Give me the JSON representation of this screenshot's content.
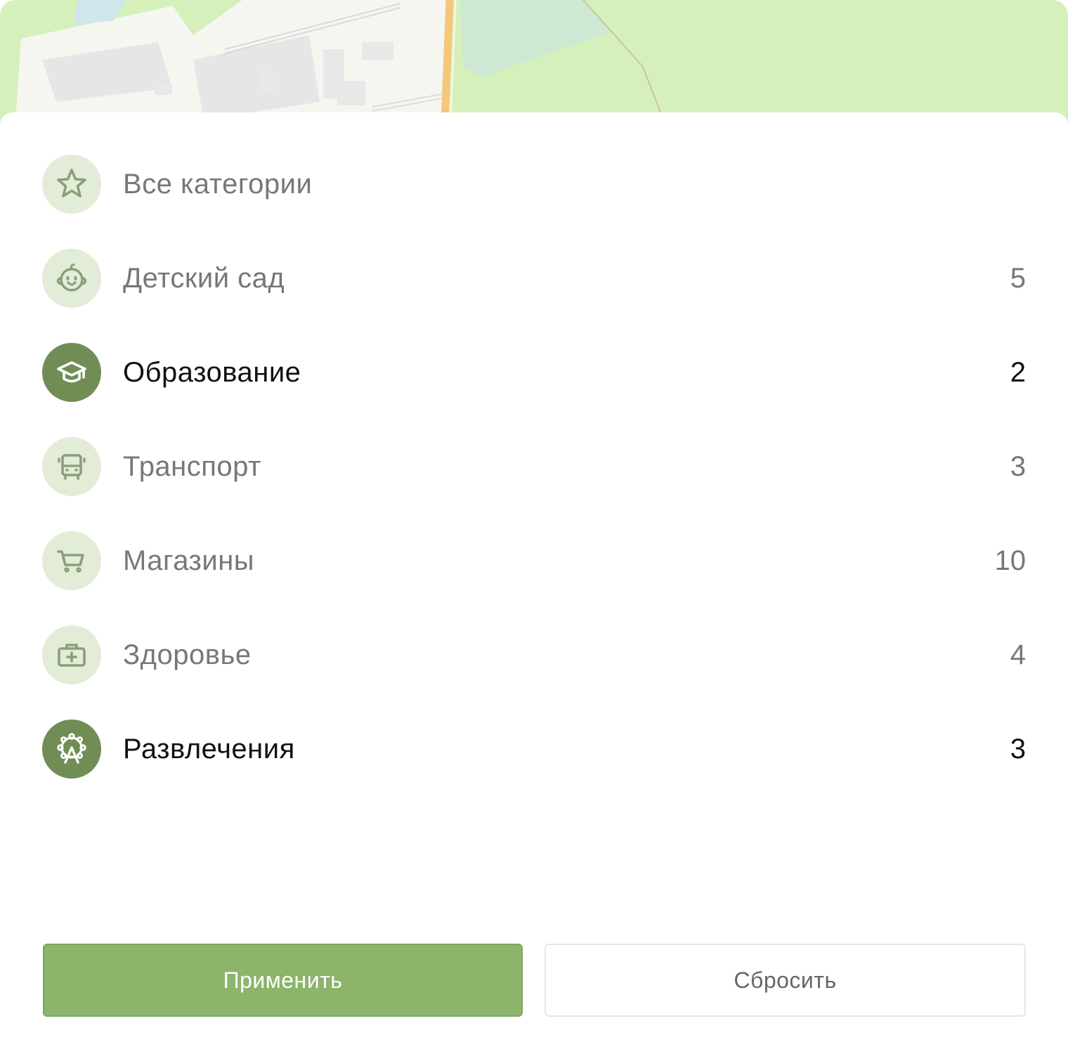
{
  "map": {
    "colors": {
      "park": "#d6f0bc",
      "block": "#f6f6f1",
      "building": "#e6e6e6",
      "road": "#f5c77b",
      "water_green": "#cde8d3"
    }
  },
  "categories": [
    {
      "label": "Все категории",
      "count": "",
      "icon": "star-icon",
      "active": false
    },
    {
      "label": "Детский сад",
      "count": "5",
      "icon": "baby-face-icon",
      "active": false
    },
    {
      "label": "Образование",
      "count": "2",
      "icon": "graduation-cap-icon",
      "active": true
    },
    {
      "label": "Транспорт",
      "count": "3",
      "icon": "bus-icon",
      "active": false
    },
    {
      "label": "Магазины",
      "count": "10",
      "icon": "shopping-cart-icon",
      "active": false
    },
    {
      "label": "Здоровье",
      "count": "4",
      "icon": "first-aid-kit-icon",
      "active": false
    },
    {
      "label": "Развлечения",
      "count": "3",
      "icon": "ferris-wheel-icon",
      "active": true
    }
  ],
  "actions": {
    "apply_label": "Применить",
    "reset_label": "Сбросить"
  },
  "colors": {
    "accent": "#8cb46b",
    "active_icon_bg": "#718d56",
    "inactive_icon_bg": "#e2ecd6",
    "inactive_text": "#777777",
    "active_text": "#111111"
  }
}
